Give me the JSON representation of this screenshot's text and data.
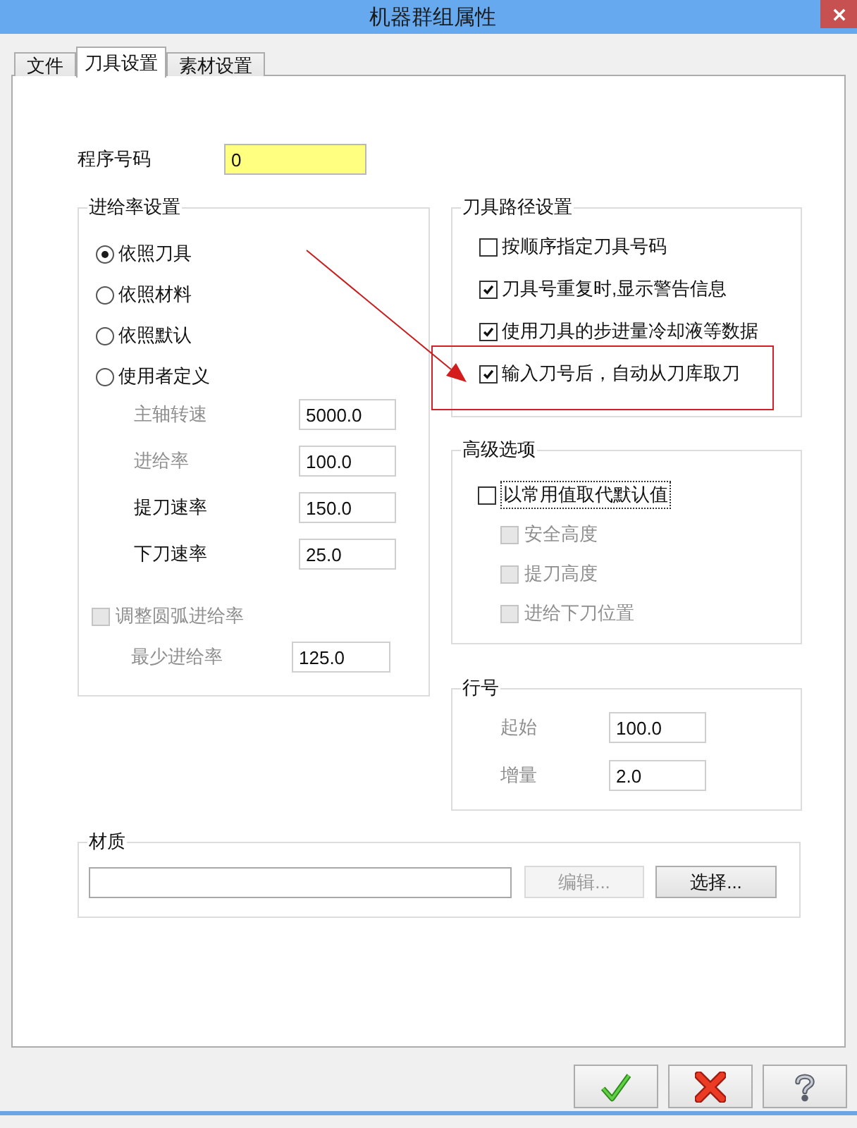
{
  "window": {
    "title": "机器群组属性"
  },
  "tabs": [
    {
      "label": "文件",
      "selected": false
    },
    {
      "label": "刀具设置",
      "selected": true
    },
    {
      "label": "素材设置",
      "selected": false
    }
  ],
  "program_number": {
    "label": "程序号码",
    "value": "0"
  },
  "feed_rate_settings": {
    "title": "进给率设置",
    "modes": [
      {
        "label": "依照刀具",
        "selected": true
      },
      {
        "label": "依照材料",
        "selected": false
      },
      {
        "label": "依照默认",
        "selected": false
      },
      {
        "label": "使用者定义",
        "selected": false
      }
    ],
    "fields": [
      {
        "label": "主轴转速",
        "value": "5000.0",
        "disabled": true
      },
      {
        "label": "进给率",
        "value": "100.0",
        "disabled": true
      },
      {
        "label": "提刀速率",
        "value": "150.0",
        "disabled": false
      },
      {
        "label": "下刀速率",
        "value": "25.0",
        "disabled": false
      }
    ],
    "arc_feed_adjust": {
      "label": "调整圆弧进给率",
      "checked": false,
      "disabled": true
    },
    "min_feed_rate": {
      "label": "最少进给率",
      "value": "125.0",
      "disabled": true
    }
  },
  "tool_path_settings": {
    "title": "刀具路径设置",
    "options": [
      {
        "label": "按顺序指定刀具号码",
        "checked": false,
        "highlighted": false
      },
      {
        "label": "刀具号重复时,显示警告信息",
        "checked": true,
        "highlighted": false
      },
      {
        "label": "使用刀具的步进量冷却液等数据",
        "checked": true,
        "highlighted": false
      },
      {
        "label": "输入刀号后，自动从刀库取刀",
        "checked": true,
        "highlighted": true
      }
    ]
  },
  "advanced_options": {
    "title": "高级选项",
    "override": {
      "label": "以常用值取代默认值",
      "checked": false,
      "focused": true
    },
    "options": [
      {
        "label": "安全高度",
        "checked": false,
        "disabled": true
      },
      {
        "label": "提刀高度",
        "checked": false,
        "disabled": true
      },
      {
        "label": "进给下刀位置",
        "checked": false,
        "disabled": true
      }
    ]
  },
  "line_numbers": {
    "title": "行号",
    "fields": [
      {
        "label": "起始",
        "value": "100.0",
        "disabled": true
      },
      {
        "label": "增量",
        "value": "2.0",
        "disabled": true
      }
    ]
  },
  "material": {
    "title": "材质",
    "buttons": [
      {
        "label": "编辑...",
        "disabled": true
      },
      {
        "label": "选择...",
        "disabled": false
      }
    ]
  },
  "dialog_buttons": [
    {
      "kind": "ok"
    },
    {
      "kind": "cancel"
    },
    {
      "kind": "help"
    }
  ]
}
